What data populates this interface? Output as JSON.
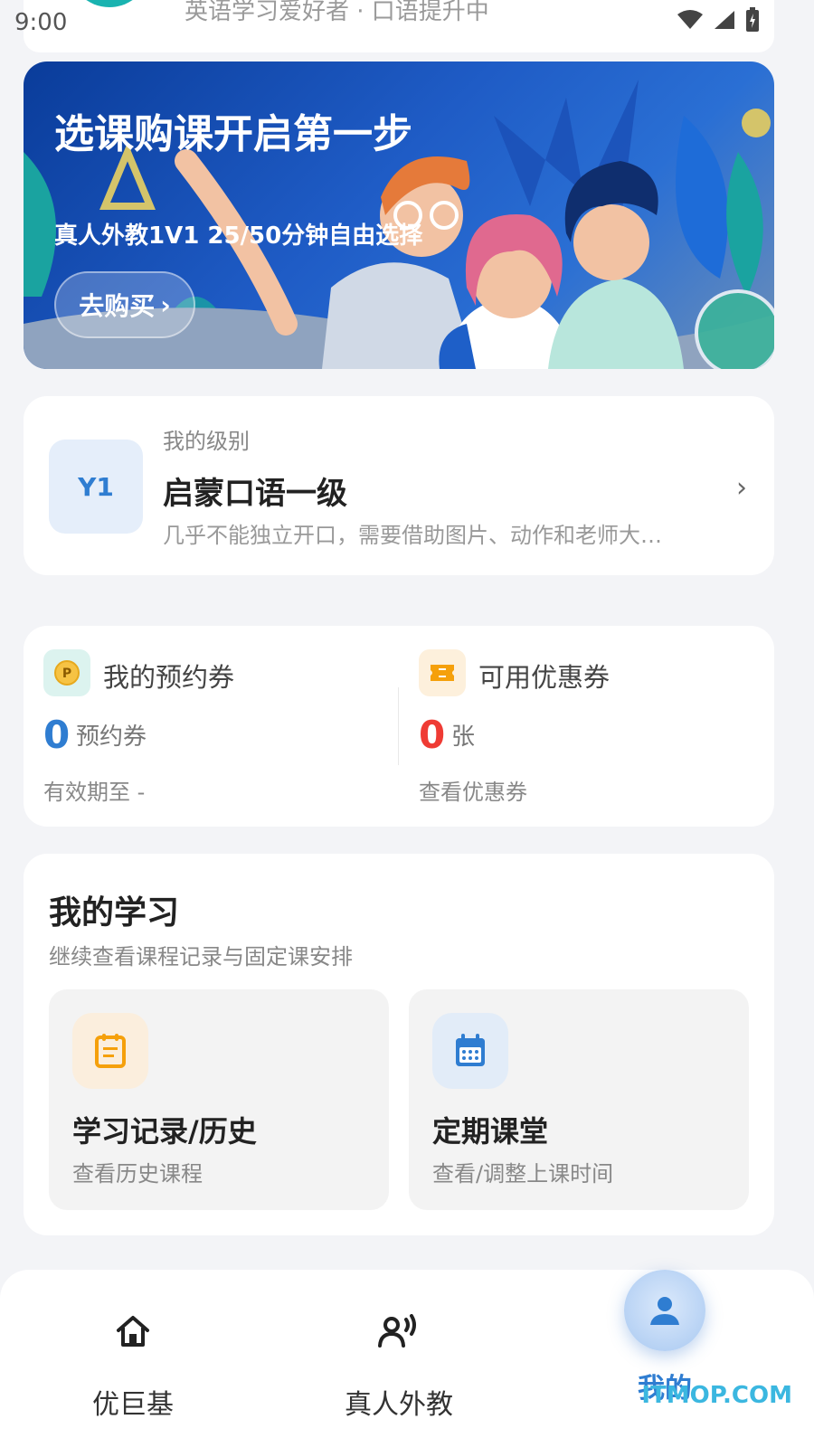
{
  "status_bar": {
    "time": "9:00"
  },
  "profile": {
    "subtitle": "英语学习爱好者 · 口语提升中"
  },
  "banner": {
    "title": "选课购课开启第一步",
    "subtitle": "真人外教1V1  25/50分钟自由选择",
    "button_label": "去购买",
    "button_arrow": "›"
  },
  "level": {
    "badge": "Y1",
    "caption": "我的级别",
    "name": "启蒙口语一级",
    "description": "几乎不能独立开口，需要借助图片、动作和老师大…",
    "chevron": "›"
  },
  "coupons": {
    "booking": {
      "title": "我的预约券",
      "value": "0",
      "unit": "预约券",
      "footer": "有效期至 -",
      "accent": "#2f7dd1"
    },
    "discount": {
      "title": "可用优惠券",
      "value": "0",
      "unit": "张",
      "footer": "查看优惠券",
      "accent": "#ef3b34"
    }
  },
  "learning": {
    "title": "我的学习",
    "subtitle": "继续查看课程记录与固定课安排",
    "tiles": [
      {
        "title": "学习记录/历史",
        "subtitle": "查看历史课程",
        "icon": "document-icon",
        "color": "#f5a00b"
      },
      {
        "title": "定期课堂",
        "subtitle": "查看/调整上课时间",
        "icon": "calendar-icon",
        "color": "#2f7dd1"
      }
    ]
  },
  "nav": {
    "items": [
      {
        "label": "优巨基",
        "icon": "home-icon"
      },
      {
        "label": "真人外教",
        "icon": "teacher-speaking-icon"
      },
      {
        "label": "我的",
        "icon": "user-icon",
        "active": true
      }
    ]
  },
  "watermark": "ITMOP.COM"
}
